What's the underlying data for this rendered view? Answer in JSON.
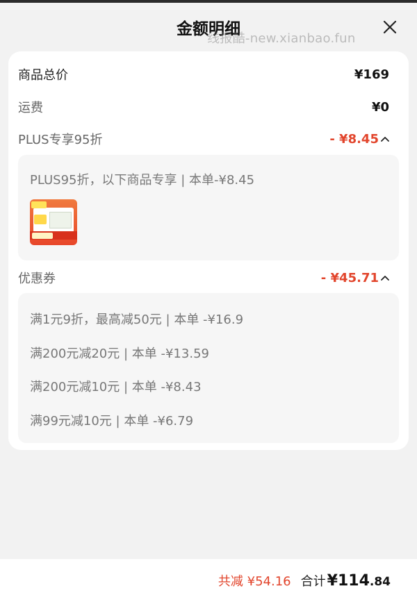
{
  "header": {
    "title": "金额明细",
    "watermark": "线报酷-new.xianbao.fun"
  },
  "rows": {
    "goods_total": {
      "label": "商品总价",
      "value": "¥169"
    },
    "shipping": {
      "label": "运费",
      "value": "¥0"
    },
    "plus": {
      "label": "PLUS专享95折",
      "value": "- ¥8.45"
    },
    "coupon": {
      "label": "优惠券",
      "value": "- ¥45.71"
    }
  },
  "plus_detail": {
    "text": "PLUS95折，以下商品专享 | 本单-¥8.45"
  },
  "coupon_detail": {
    "items": [
      "满1元9折，最高减50元 | 本单 -¥16.9",
      "满200元减20元 | 本单 -¥13.59",
      "满200元减10元 | 本单 -¥8.43",
      "满99元减10元 | 本单 -¥6.79"
    ]
  },
  "footer": {
    "reduce": "共减 ¥54.16",
    "total_label": "合计",
    "total_int": "¥114",
    "total_dec": ".84"
  },
  "colors": {
    "accent_red": "#e2452c",
    "background": "#f2f2f2",
    "card": "#ffffff"
  }
}
